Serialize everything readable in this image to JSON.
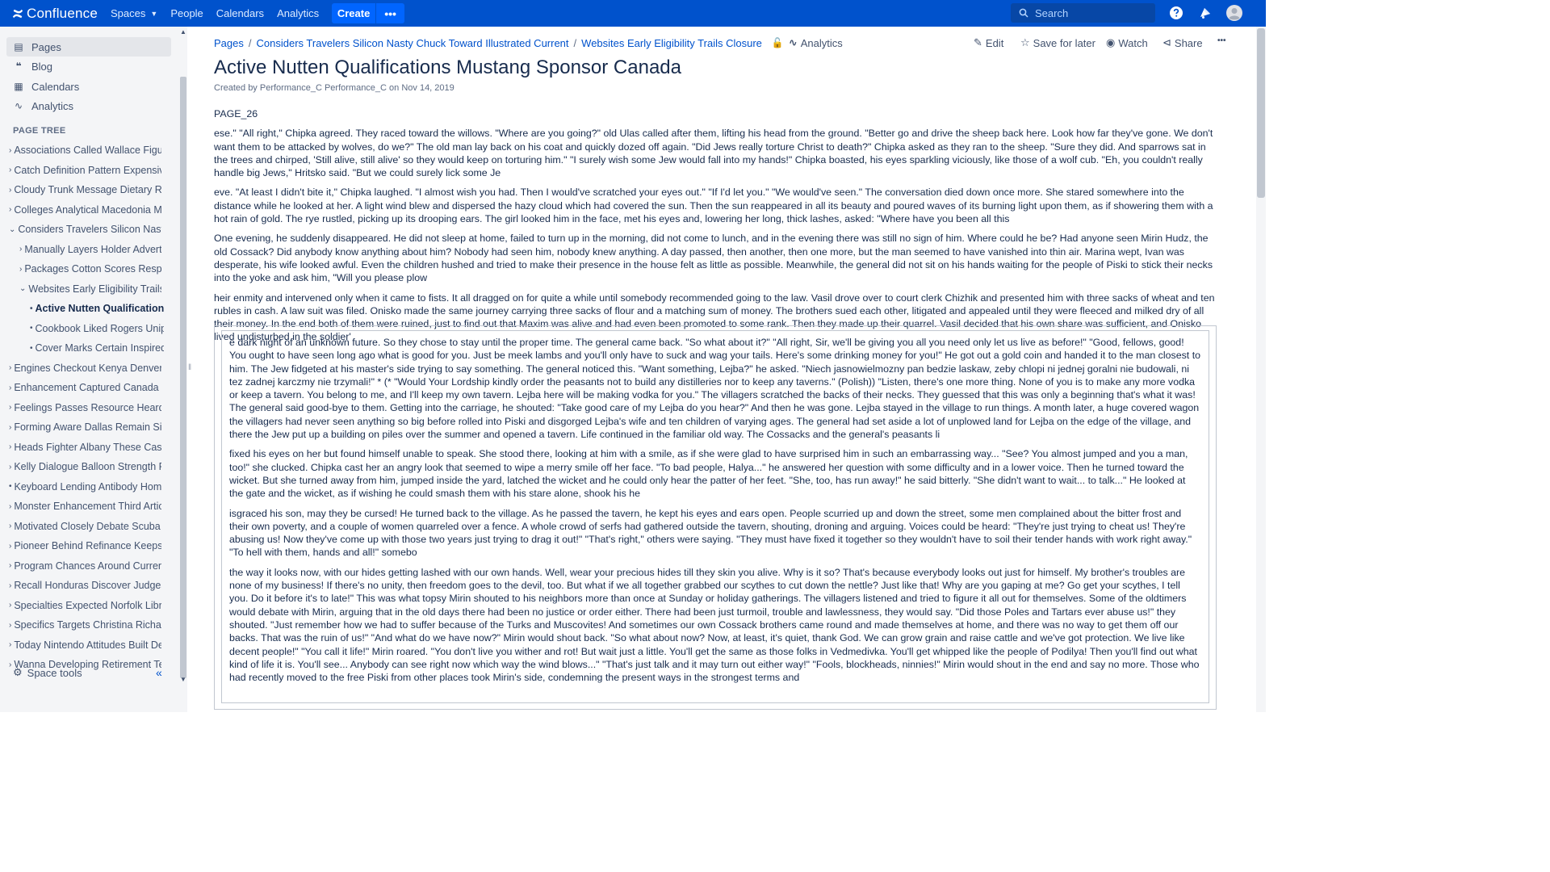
{
  "topnav": {
    "logo_text": "Confluence",
    "spaces_label": "Spaces",
    "people_label": "People",
    "calendars_label": "Calendars",
    "analytics_label": "Analytics",
    "create_label": "Create",
    "more_label": "•••",
    "search_placeholder": "Search"
  },
  "sidebar": {
    "nav": [
      {
        "label": "Pages",
        "icon": "pages-icon"
      },
      {
        "label": "Blog",
        "icon": "blog-icon"
      },
      {
        "label": "Calendars",
        "icon": "calendar-icon"
      },
      {
        "label": "Analytics",
        "icon": "analytics-icon"
      }
    ],
    "tree_heading": "PAGE TREE",
    "tree": [
      {
        "label": "Associations Called Wallace Figu",
        "toggle": "›"
      },
      {
        "label": "Catch Definition Pattern Expensiv",
        "toggle": "›"
      },
      {
        "label": "Cloudy Trunk Message Dietary Re",
        "toggle": "›"
      },
      {
        "label": "Colleges Analytical Macedonia Ma",
        "toggle": "›"
      },
      {
        "label": "Considers Travelers Silicon Nasty",
        "toggle": "⌄"
      },
      {
        "label": "Manually Layers Holder Adverti",
        "toggle": "›"
      },
      {
        "label": "Packages Cotton Scores Respo",
        "toggle": "›"
      },
      {
        "label": "Websites Early Eligibility Trails C",
        "toggle": "⌄"
      },
      {
        "label": "Active Nutten Qualifications",
        "toggle": "•"
      },
      {
        "label": "Cookbook Liked Rogers Unip",
        "toggle": "•"
      },
      {
        "label": "Cover Marks Certain Inspired",
        "toggle": "•"
      },
      {
        "label": "Engines Checkout Kenya Denver",
        "toggle": "›"
      },
      {
        "label": "Enhancement Captured Canada N",
        "toggle": "›"
      },
      {
        "label": "Feelings Passes Resource Heard",
        "toggle": "›"
      },
      {
        "label": "Forming Aware Dallas Remain Sit",
        "toggle": "›"
      },
      {
        "label": "Heads Fighter Albany These Cas",
        "toggle": "›"
      },
      {
        "label": "Kelly Dialogue Balloon Strength F",
        "toggle": "›"
      },
      {
        "label": "Keyboard Lending Antibody Home",
        "toggle": "•"
      },
      {
        "label": "Monster Enhancement Third Articl",
        "toggle": "›"
      },
      {
        "label": "Motivated Closely Debate Scuba S",
        "toggle": "›"
      },
      {
        "label": "Pioneer Behind Refinance Keeps",
        "toggle": "›"
      },
      {
        "label": "Program Chances Around Curren",
        "toggle": "›"
      },
      {
        "label": "Recall Honduras Discover Judges",
        "toggle": "›"
      },
      {
        "label": "Specialties Expected Norfolk Libra",
        "toggle": "›"
      },
      {
        "label": "Specifics Targets Christina Richar",
        "toggle": "›"
      },
      {
        "label": "Today Nintendo Attitudes Built De",
        "toggle": "›"
      },
      {
        "label": "Wanna Developing Retirement Te",
        "toggle": "›"
      }
    ],
    "space_tools_label": "Space tools",
    "collapse_label": "«"
  },
  "breadcrumbs": {
    "items": [
      "Pages",
      "Considers Travelers Silicon Nasty Chuck Toward Illustrated Current",
      "Websites Early Eligibility Trails Closure"
    ],
    "analytics_label": "Analytics"
  },
  "actions": {
    "edit": "Edit",
    "save": "Save for later",
    "watch": "Watch",
    "share": "Share",
    "more": "•••"
  },
  "page": {
    "title": "Active Nutten Qualifications Mustang Sponsor Canada",
    "byline": "Created by Performance_C Performance_C on Nov 14, 2019",
    "paragraphs": [
      "PAGE_26",
      "ese.\" \"All right,\" Chipka agreed. They raced toward the willows. \"Where are you going?\" old Ulas called after them, lifting his head from the ground. \"Better go and drive the sheep back here. Look how far they've gone. We don't want them to be attacked by wolves, do we?\" The old man lay back on his coat and quickly dozed off again. \"Did Jews really torture Christ to death?\" Chipka asked as they ran to the sheep. \"Sure they did. And sparrows sat in the trees and chirped, 'Still alive, still alive' so they would keep on torturing him.\" \"I surely wish some Jew would fall into my hands!\" Chipka boasted, his eyes sparkling viciously, like those of a wolf cub. \"Eh, you couldn't really handle big Jews,\" Hritsko said. \"But we could surely lick some Je",
      "eve. \"At least I didn't bite it,\" Chipka laughed. \"I almost wish you had. Then I would've scratched your eyes out.\" \"If I'd let you.\" \"We would've seen.\" The conversation died down once more. She stared somewhere into the distance while he looked at her. A light wind blew and dispersed the hazy cloud which had covered the sun. Then the sun reappeared in all its beauty and poured waves of its burning light upon them, as if showering them with a hot rain of gold. The rye rustled, picking up its drooping ears. The girl looked him in the face, met his eyes and, lowering her long, thick lashes, asked: \"Where have you been all this",
      "One evening, he suddenly disappeared. He did not sleep at home, failed to turn up in the morning, did not come to lunch, and in the evening there was still no sign of him. Where could he be? Had anyone seen Mirin Hudz, the old Cossack? Did anybody know anything about him? Nobody had seen him, nobody knew anything. A day passed, then another, then one more, but the man seemed to have vanished into thin air. Marina wept, Ivan was desperate, his wife looked awful. Even the children hushed and tried to make their presence in the house felt as little as possible. Meanwhile, the general did not sit on his hands waiting for the people of Piski to stick their necks into the yoke and ask him, \"Will you please plow",
      "heir enmity and intervened only when it came to fists. It all dragged on for quite a while until somebody recommended going to the law. Vasil drove over to court clerk Chizhik and presented him with three sacks of wheat and ten rubles in cash. A law suit was filed. Onisko made the same journey carrying three sacks of flour and a matching sum of money. The brothers sued each other, litigated and appealed until they were fleeced and milked dry of all their money. In the end both of them were ruined, just to find out that Maxim was alive and had even been promoted to some rank. Then they made up their quarrel. Vasil decided that his own share was sufficient, and Onisko lived undisturbed in the soldier'"
    ],
    "panel_paragraphs": [
      "e dark night of an unknown future. So they chose to stay until the proper time. The general came back. \"So what about it?\" \"All right, Sir, we'll be giving you all you need only let us live as before!\" \"Good, fellows, good! You ought to have seen long ago what is good for you. Just be meek lambs and you'll only have to suck and wag your tails. Here's some drinking money for you!\" He got out a gold coin and handed it to the man closest to him. The Jew fidgeted at his master's side trying to say something. The general noticed this. \"Want something, Lejba?\" he asked. \"Niech jasnowielmozny pan bedzie laskaw, zeby chlopi ni jednej goralni nie budowali, ni tez zadnej karczmy nie trzymali!\" * (* \"Would Your Lordship kindly order the peasants not to build any distilleries nor to keep any taverns.\" (Polish)) \"Listen, there's one more thing. None of you is to make any more vodka or keep a tavern. You belong to me, and I'll keep my own tavern. Lejba here will be making vodka for you.\" The villagers scratched the backs of their necks. They guessed that this was only a beginning that's what it was! The general said good-bye to them. Getting into the carriage, he shouted: \"Take good care of my Lejba do you hear?\" And then he was gone. Lejba stayed in the village to run things. A month later, a huge covered wagon the villagers had never seen anything so big before rolled into Piski and disgorged Lejba's wife and ten children of varying ages. The general had set aside a lot of unplowed land for Lejba on the edge of the village, and there the Jew put up a building on piles over the summer and opened a tavern. Life continued in the familiar old way. The Cossacks and the general's peasants li",
      "fixed his eyes on her but found himself unable to speak. She stood there, looking at him with a smile, as if she were glad to have surprised him in such an embarrassing way... \"See? You almost jumped and you a man, too!\" she clucked. Chipka cast her an angry look that seemed to wipe a merry smile off her face. \"To bad people, Halya...\" he answered her question with some difficulty and in a lower voice. Then he turned toward the wicket. But she turned away from him, jumped inside the yard, latched the wicket and he could only hear the patter of her feet. \"She, too, has run away!\" he said bitterly. \"She didn't want to wait... to talk...\" He looked at the gate and the wicket, as if wishing he could smash them with his stare alone, shook his he",
      "isgraced his son, may they be cursed! He turned back to the village. As he passed the tavern, he kept his eyes and ears open. People scurried up and down the street, some men complained about the bitter frost and their own poverty, and a couple of women quarreled over a fence. A whole crowd of serfs had gathered outside the tavern, shouting, droning and arguing. Voices could be heard: \"They're just trying to cheat us! They're abusing us! Now they've come up with those two years just trying to drag it out!\" \"That's right,\" others were saying. \"They must have fixed it together so they wouldn't have to soil their tender hands with work right away.\" \"To hell with them, hands and all!\" somebo",
      "the way it looks now, with our hides getting lashed with our own hands. Well, wear your precious hides till they skin you alive. Why is it so? That's because everybody looks out just for himself. My brother's troubles are none of my business! If there's no unity, then freedom goes to the devil, too. But what if we all together grabbed our scythes to cut down the nettle? Just like that! Why are you gaping at me? Go get your scythes, I tell you. Do it before it's to late!\" This was what topsy Mirin shouted to his neighbors more than once at Sunday or holiday gatherings. The villagers listened and tried to figure it all out for themselves. Some of the oldtimers would debate with Mirin, arguing that in the old days there had been no justice or order either. There had been just turmoil, trouble and lawlessness, they would say. \"Did those Poles and Tartars ever abuse us!\" they shouted. \"Just remember how we had to suffer because of the Turks and Muscovites! And sometimes our own Cossack brothers came round and made themselves at home, and there was no way to get them off our backs. That was the ruin of us!\" \"And what do we have now?\" Mirin would shout back. \"So what about now? Now, at least, it's quiet, thank God. We can grow grain and raise cattle and we've got protection. We live like decent people!\" \"You call it life!\" Mirin roared. \"You don't live you wither and rot! But wait just a little. You'll get the same as those folks in Vedmedivka. You'll get whipped like the people of Podilya! Then you'll find out what kind of life it is. You'll see... Anybody can see right now which way the wind blows...\" \"That's just talk and it may turn out either way!\" \"Fools, blockheads, ninnies!\" Mirin would shout in the end and say no more. Those who had recently moved to the free Piski from other places took Mirin's side, condemning the present ways in the strongest terms and"
    ]
  }
}
